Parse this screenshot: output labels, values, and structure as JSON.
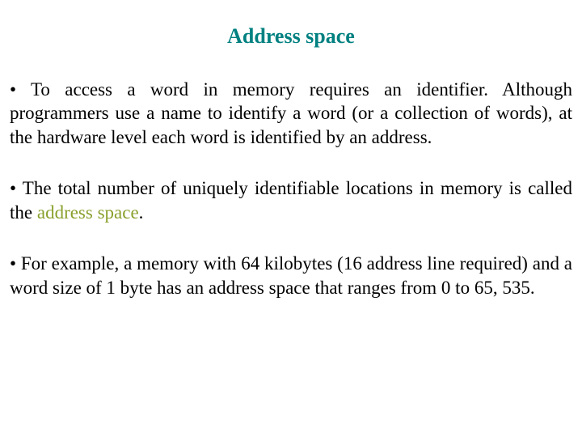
{
  "title": "Address space",
  "paragraphs": {
    "p1": {
      "bullet": "• ",
      "text": "To access a word in memory requires an identifier. Although programmers use a name to identify a word (or a collection of words), at the hardware level each word is identified by an address."
    },
    "p2": {
      "bullet": "• ",
      "lead": "The total number of uniquely identifiable locations in memory is called the ",
      "term": "address space",
      "tail": "."
    },
    "p3": {
      "bullet": "• ",
      "text": "For example, a memory with 64 kilobytes (16 address line required) and a word size of 1 byte has an address space that ranges from 0 to 65, 535."
    }
  }
}
